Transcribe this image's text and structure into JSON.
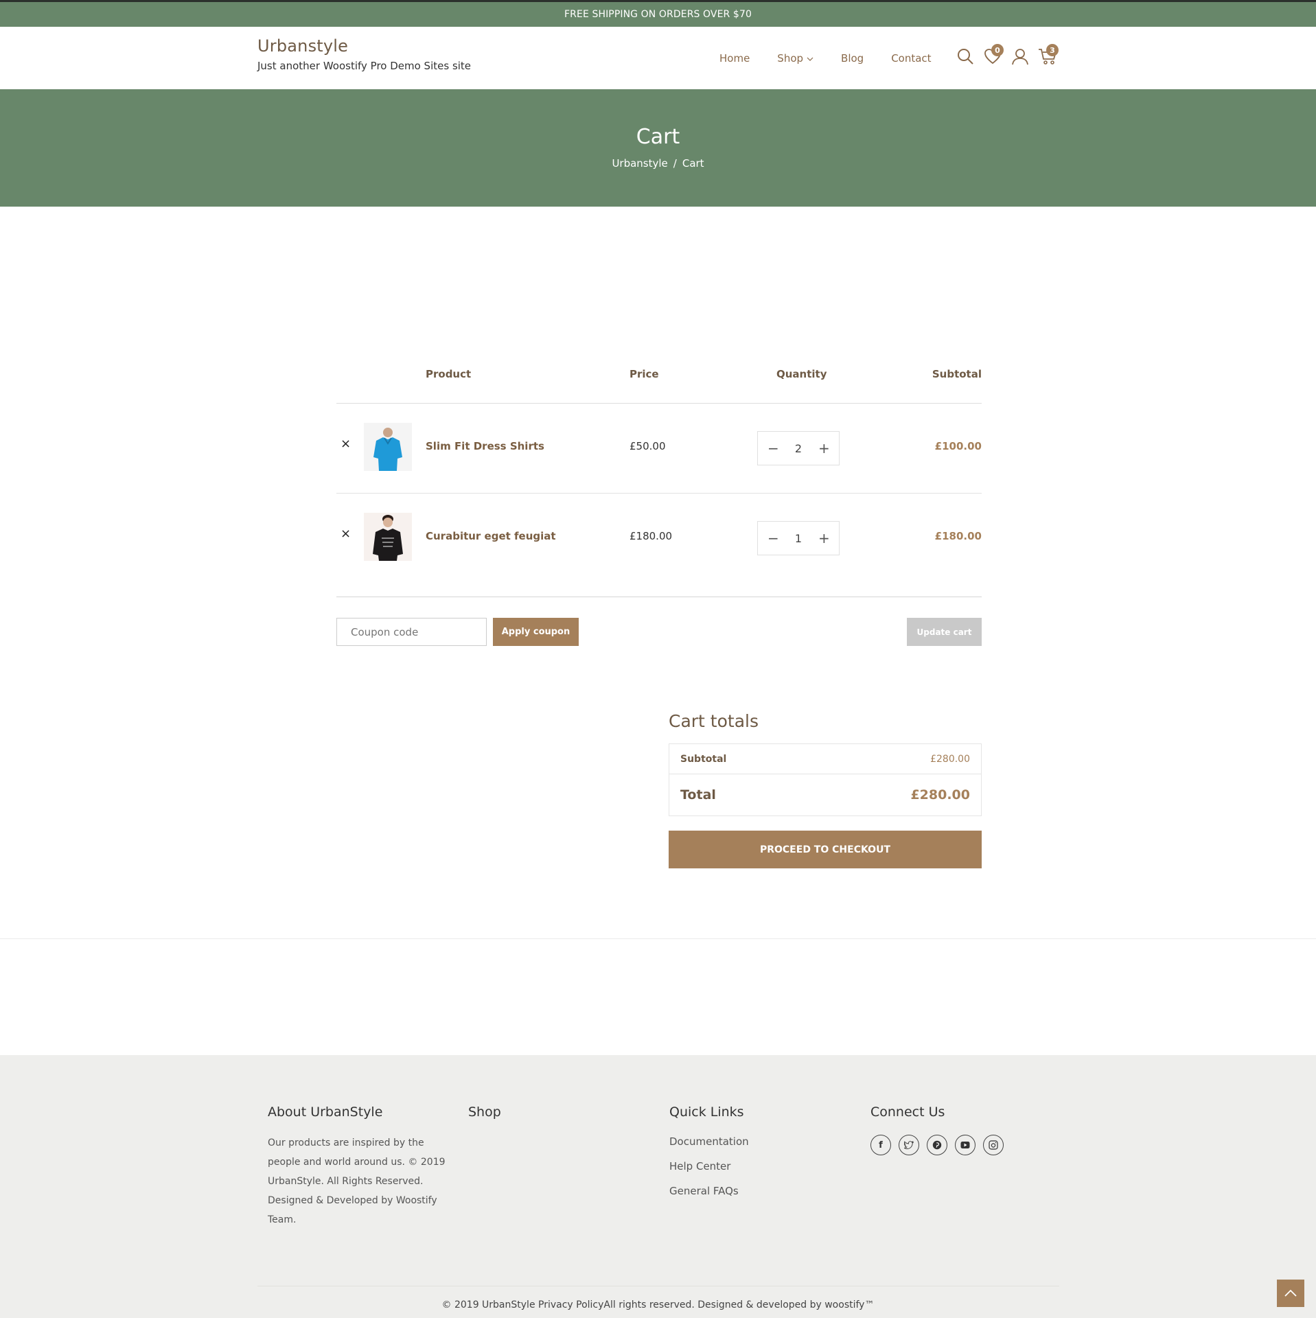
{
  "topbar": {
    "text": "FREE SHIPPING ON ORDERS OVER $70"
  },
  "header": {
    "site_name": "Urbanstyle",
    "tagline": "Just another Woostify Pro Demo Sites site",
    "nav": [
      "Home",
      "Shop",
      "Blog",
      "Contact"
    ],
    "wishlist_count": "0",
    "cart_count": "3"
  },
  "hero": {
    "title": "Cart",
    "breadcrumb": [
      "Urbanstyle",
      "/",
      "Cart"
    ]
  },
  "cart": {
    "headers": {
      "product": "Product",
      "price": "Price",
      "quantity": "Quantity",
      "subtotal": "Subtotal"
    },
    "items": [
      {
        "name": "Slim Fit Dress Shirts",
        "price": "£50.00",
        "quantity": "2",
        "subtotal": "£100.00",
        "remove": "×",
        "minus": "−",
        "plus": "+"
      },
      {
        "name": "Curabitur eget feugiat",
        "price": "£180.00",
        "quantity": "1",
        "subtotal": "£180.00",
        "remove": "×",
        "minus": "−",
        "plus": "+"
      }
    ],
    "coupon_placeholder": "Coupon code",
    "apply_label": "Apply coupon",
    "update_label": "Update cart"
  },
  "totals": {
    "heading": "Cart totals",
    "subtotal_label": "Subtotal",
    "subtotal_value": "£280.00",
    "total_label": "Total",
    "total_value": "£280.00",
    "checkout_label": "PROCEED TO CHECKOUT"
  },
  "footer": {
    "about": {
      "title": "About UrbanStyle",
      "text": "Our products are inspired by the people and world around us. © 2019 UrbanStyle. All Rights Reserved. Designed & Developed by Woostify Team."
    },
    "shop": {
      "title": "Shop"
    },
    "quick": {
      "title": "Quick Links",
      "links": [
        "Documentation",
        "Help Center",
        "General FAQs"
      ]
    },
    "connect": {
      "title": "Connect Us",
      "icons": [
        "facebook-icon",
        "twitter-icon",
        "pinterest-icon",
        "youtube-icon",
        "instagram-icon"
      ]
    },
    "copyright": "© 2019 UrbanStyle Privacy PolicyAll rights reserved. Designed & developed by woostify™"
  },
  "colors": {
    "green": "#68876a",
    "brown": "#a5805a",
    "footer_bg": "#eeeeec"
  }
}
